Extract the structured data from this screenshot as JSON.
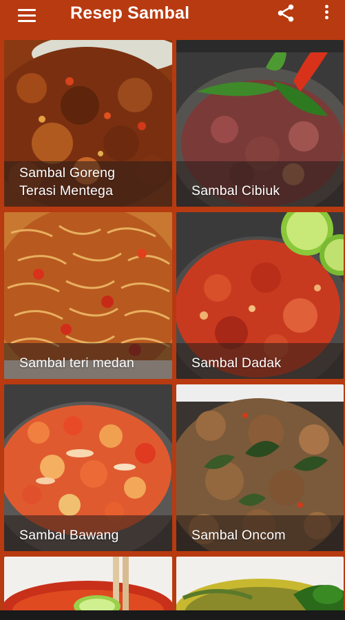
{
  "app": {
    "title": "Resep Sambal",
    "icons": {
      "menu": "hamburger-menu-icon",
      "share": "share-icon",
      "more": "more-vert-icon"
    },
    "colors": {
      "primary": "#b83a10",
      "caption_overlay": "#281e19",
      "text": "#ffffff"
    }
  },
  "recipes": [
    {
      "name": "Sambal Goreng\nTerasi Mentega"
    },
    {
      "name": "Sambal Cibiuk"
    },
    {
      "name": "Sambal teri medan"
    },
    {
      "name": "Sambal Dadak"
    },
    {
      "name": "Sambal Bawang"
    },
    {
      "name": "Sambal Oncom"
    },
    {
      "name": ""
    },
    {
      "name": ""
    }
  ]
}
